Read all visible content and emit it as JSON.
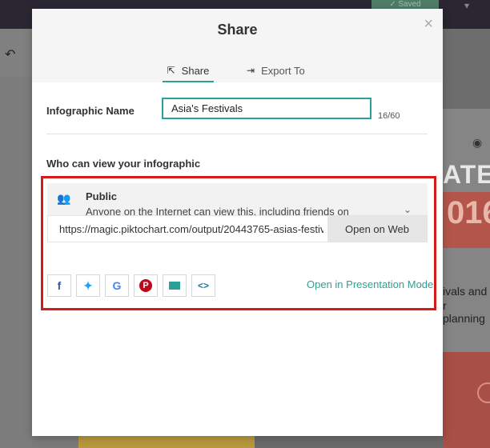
{
  "background": {
    "saved_label": "✓ Saved",
    "undo_icon": "↶",
    "eye_icon": "👁",
    "poster_heading": "ATE",
    "poster_year": "016",
    "poster_copy1": "ivals and",
    "poster_copy2": "r planning"
  },
  "modal": {
    "title": "Share",
    "close_icon": "×",
    "tabs": [
      {
        "label": "Share",
        "icon": "share-icon",
        "active": true
      },
      {
        "label": "Export To",
        "icon": "export-icon",
        "active": false
      }
    ],
    "name_label": "Infographic Name",
    "name_value": "Asia's Festivals",
    "char_count": "16/60",
    "who_label": "Who can view your infographic",
    "visibility": {
      "title": "Public",
      "description": "Anyone on the Internet can view this, including friends on social media."
    },
    "link_url": "https://magic.piktochart.com/output/20443765-asias-festiv",
    "open_on_web": "Open on Web",
    "social": [
      {
        "name": "facebook-icon",
        "glyph": "f"
      },
      {
        "name": "twitter-icon",
        "glyph": "🐦"
      },
      {
        "name": "google-icon",
        "glyph": "G"
      },
      {
        "name": "pinterest-icon",
        "glyph": "P"
      },
      {
        "name": "email-icon",
        "glyph": ""
      },
      {
        "name": "embed-icon",
        "glyph": "<>"
      }
    ],
    "presentation_link": "Open in Presentation Mode"
  },
  "colors": {
    "accent": "#2aa198",
    "highlight": "#d61a1a",
    "facebook": "#3b5998",
    "twitter": "#1da1f2",
    "pinterest": "#bd081c"
  }
}
